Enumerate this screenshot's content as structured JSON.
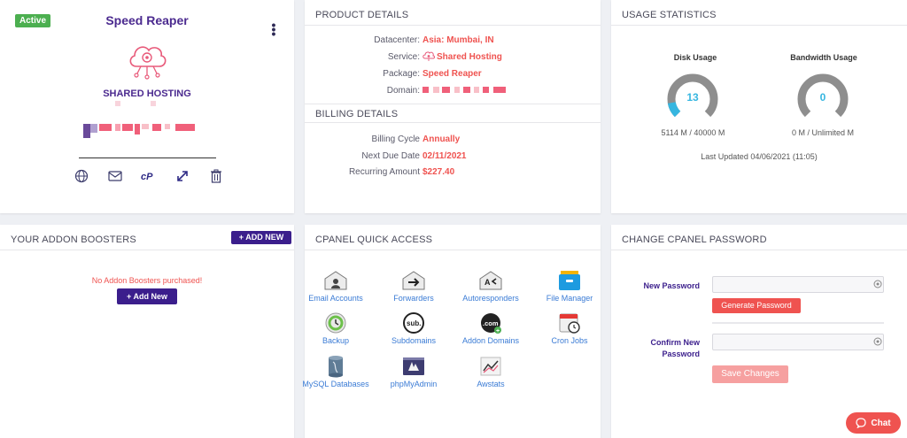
{
  "service_card": {
    "status_badge": "Active",
    "name": "Speed Reaper",
    "type_title": "SHARED HOSTING",
    "icons": [
      "globe-icon",
      "mail-icon",
      "cpanel-icon",
      "expand-icon",
      "trash-icon"
    ]
  },
  "product_details": {
    "header": "PRODUCT DETAILS",
    "rows": [
      {
        "label": "Datacenter:",
        "value": "Asia: Mumbai, IN"
      },
      {
        "label": "Service:",
        "value": "Shared Hosting"
      },
      {
        "label": "Package:",
        "value": "Speed Reaper"
      },
      {
        "label": "Domain:",
        "value": ""
      }
    ],
    "billing_header": "BILLING DETAILS",
    "billing_rows": [
      {
        "label": "Billing Cycle",
        "value": "Annually"
      },
      {
        "label": "Next Due Date",
        "value": "02/11/2021"
      },
      {
        "label": "Recurring Amount",
        "value": "$227.40"
      }
    ]
  },
  "usage": {
    "header": "USAGE STATISTICS",
    "disk": {
      "label": "Disk Usage",
      "value": "13",
      "detail": "5114 M / 40000 M",
      "fraction": 0.13
    },
    "bandwidth": {
      "label": "Bandwidth Usage",
      "value": "0",
      "detail": "0 M / Unlimited M",
      "fraction": 0
    },
    "last_updated": "Last Updated 04/06/2021 (11:05)"
  },
  "addons": {
    "header": "YOUR ADDON BOOSTERS",
    "add_new_top": "+ ADD NEW",
    "empty_text": "No Addon Boosters purchased!",
    "add_new_btn": "+ Add New"
  },
  "cpanel": {
    "header": "CPANEL QUICK ACCESS",
    "items": [
      {
        "label": "Email Accounts",
        "icon": "email-accounts-icon"
      },
      {
        "label": "Forwarders",
        "icon": "forwarders-icon"
      },
      {
        "label": "Autoresponders",
        "icon": "autoresponders-icon"
      },
      {
        "label": "File Manager",
        "icon": "file-manager-icon"
      },
      {
        "label": "Backup",
        "icon": "backup-icon"
      },
      {
        "label": "Subdomains",
        "icon": "subdomains-icon"
      },
      {
        "label": "Addon Domains",
        "icon": "addon-domains-icon"
      },
      {
        "label": "Cron Jobs",
        "icon": "cron-jobs-icon"
      },
      {
        "label": "MySQL Databases",
        "icon": "mysql-icon"
      },
      {
        "label": "phpMyAdmin",
        "icon": "phpmyadmin-icon"
      },
      {
        "label": "Awstats",
        "icon": "awstats-icon"
      }
    ]
  },
  "password": {
    "header": "CHANGE CPANEL PASSWORD",
    "new_label": "New Password",
    "generate_btn": "Generate Password",
    "confirm_label": "Confirm New Password",
    "save_btn": "Save Changes"
  },
  "chat": {
    "label": "Chat"
  },
  "colors": {
    "accent": "#3b1e8c",
    "danger": "#ef5350",
    "gauge_fill": "#36b6e0",
    "gauge_track": "#8e8e8e"
  }
}
